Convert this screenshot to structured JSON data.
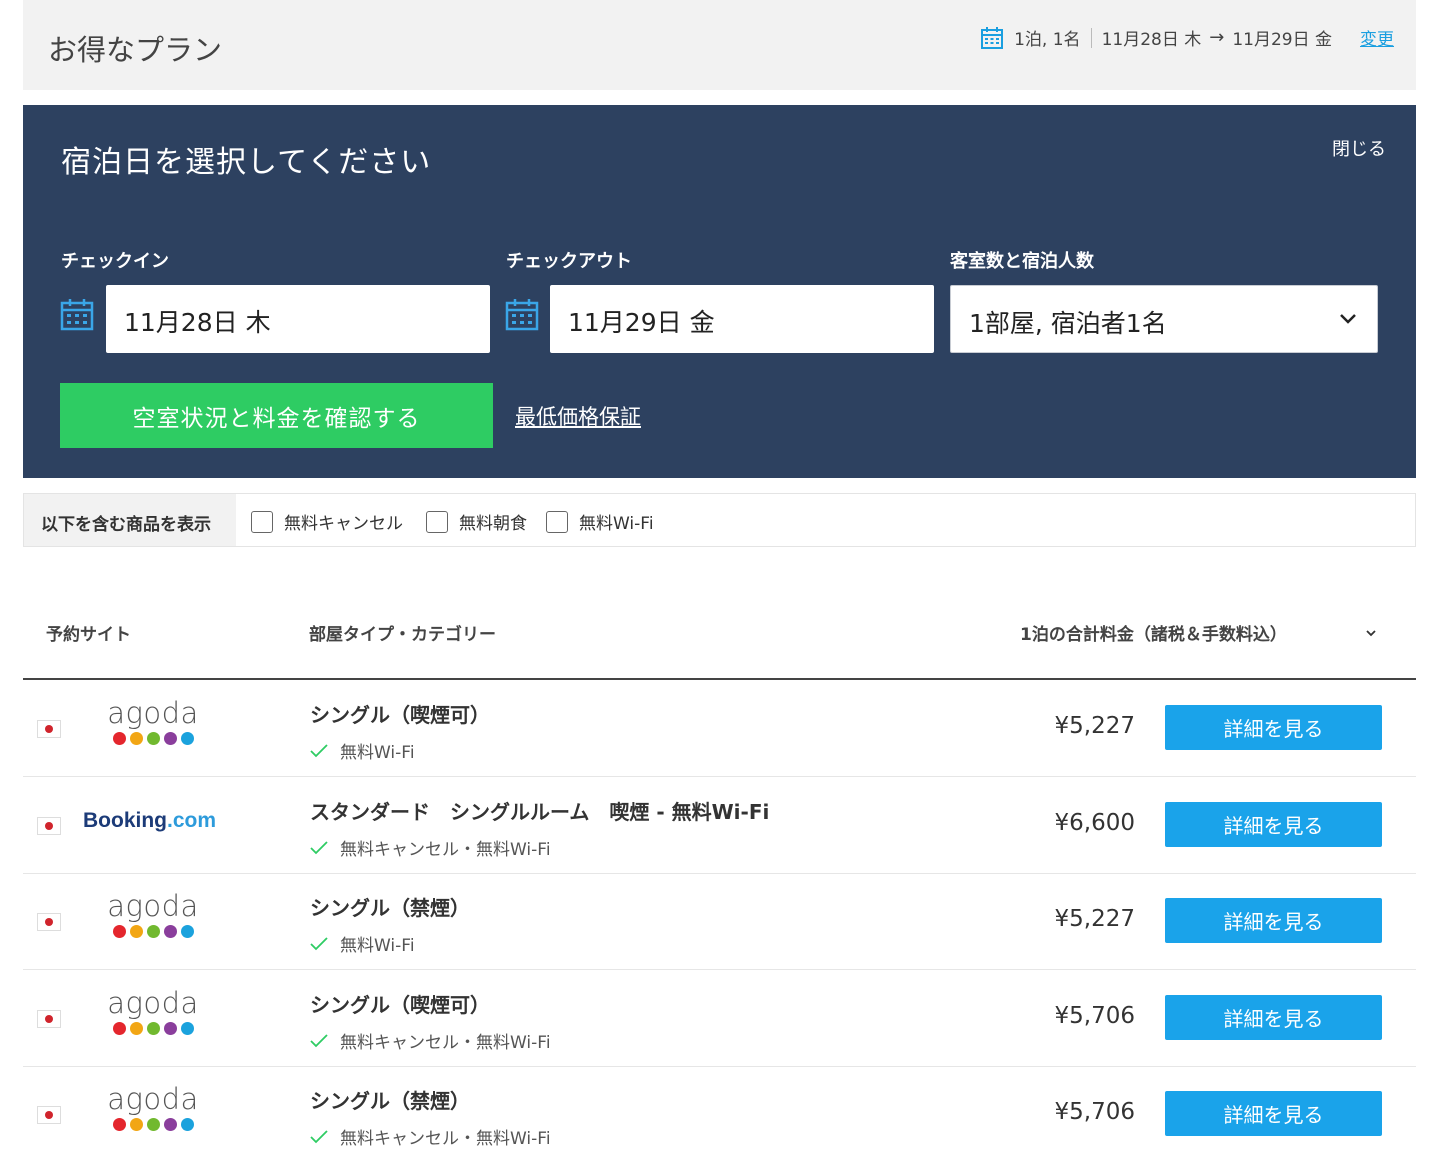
{
  "header": {
    "title": "お得なプラン",
    "stay_summary": "1泊, 1名",
    "checkin_summary": "11月28日 木",
    "arrow": "→",
    "checkout_summary": "11月29日 金",
    "change_link": "変更"
  },
  "search_panel": {
    "heading": "宿泊日を選択してください",
    "close_label": "閉じる",
    "checkin_label": "チェックイン",
    "checkin_value": "11月28日 木",
    "checkout_label": "チェックアウト",
    "checkout_value": "11月29日 金",
    "guests_label": "客室数と宿泊人数",
    "guests_value": "1部屋, 宿泊者1名",
    "search_button": "空室状況と料金を確認する",
    "guarantee_link": "最低価格保証"
  },
  "filters": {
    "label": "以下を含む商品を表示",
    "options": [
      {
        "label": "無料キャンセル",
        "checked": false
      },
      {
        "label": "無料朝食",
        "checked": false
      },
      {
        "label": "無料Wi-Fi",
        "checked": false
      }
    ]
  },
  "table": {
    "col_site": "予約サイト",
    "col_room": "部屋タイプ・カテゴリー",
    "col_price": "1泊の合計料金（諸税＆手数料込）",
    "rows": [
      {
        "site": "agoda",
        "room": "シングル（喫煙可）",
        "features": "無料Wi-Fi",
        "price": "¥5,227",
        "button": "詳細を見る"
      },
      {
        "site": "Booking.com",
        "room": "スタンダード　シングルルーム　喫煙 - 無料Wi-Fi",
        "features": "無料キャンセル・無料Wi-Fi",
        "price": "¥6,600",
        "button": "詳細を見る"
      },
      {
        "site": "agoda",
        "room": "シングル（禁煙）",
        "features": "無料Wi-Fi",
        "price": "¥5,227",
        "button": "詳細を見る"
      },
      {
        "site": "agoda",
        "room": "シングル（喫煙可）",
        "features": "無料キャンセル・無料Wi-Fi",
        "price": "¥5,706",
        "button": "詳細を見る"
      },
      {
        "site": "agoda",
        "room": "シングル（禁煙）",
        "features": "無料キャンセル・無料Wi-Fi",
        "price": "¥5,706",
        "button": "詳細を見る"
      }
    ]
  },
  "logos": {
    "agoda_word": "agoda",
    "booking_main": "Booking",
    "booking_suffix": ".com"
  },
  "colors": {
    "panel_bg": "#2d4160",
    "search_button": "#2ecc63",
    "detail_button": "#1aa3ea",
    "link": "#1a9fe0",
    "agoda_dots": [
      "#e4262d",
      "#f2a614",
      "#71b92f",
      "#8a3e9c",
      "#1ba2dd"
    ]
  },
  "icons": {
    "calendar": "calendar-icon",
    "chevron": "chevron-down-icon",
    "check": "check-icon",
    "flag": "japan-flag-icon"
  }
}
